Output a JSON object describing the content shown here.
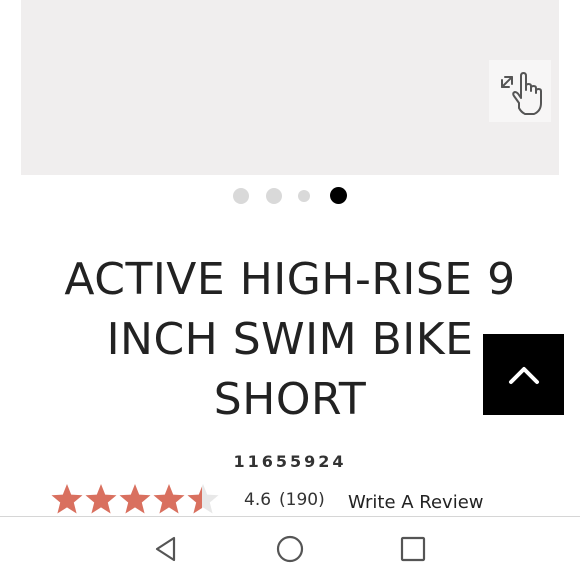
{
  "product": {
    "title_line1": "ACTIVE HIGH-RISE 9",
    "title_line2": "INCH SWIM BIKE",
    "title_line3": "SHORT",
    "sku": "11655924"
  },
  "gallery": {
    "slide_count": 4,
    "active_slide": 4,
    "zoom_icon": "expand-hand-icon"
  },
  "rating": {
    "value": "4.6",
    "count": "(190)",
    "stars_filled_fraction": 0.92,
    "write_review_label": "Write A Review",
    "star_color": "#d9705f"
  },
  "back_to_top_icon": "chevron-up-icon",
  "nav": {
    "back_icon": "triangle-back-icon",
    "home_icon": "circle-home-icon",
    "recents_icon": "square-recents-icon"
  },
  "colors": {
    "image_bg": "#f0eeee",
    "dot_active": "#000000",
    "dot_inactive": "#d9d9d9",
    "back_to_top_bg": "#000000"
  }
}
